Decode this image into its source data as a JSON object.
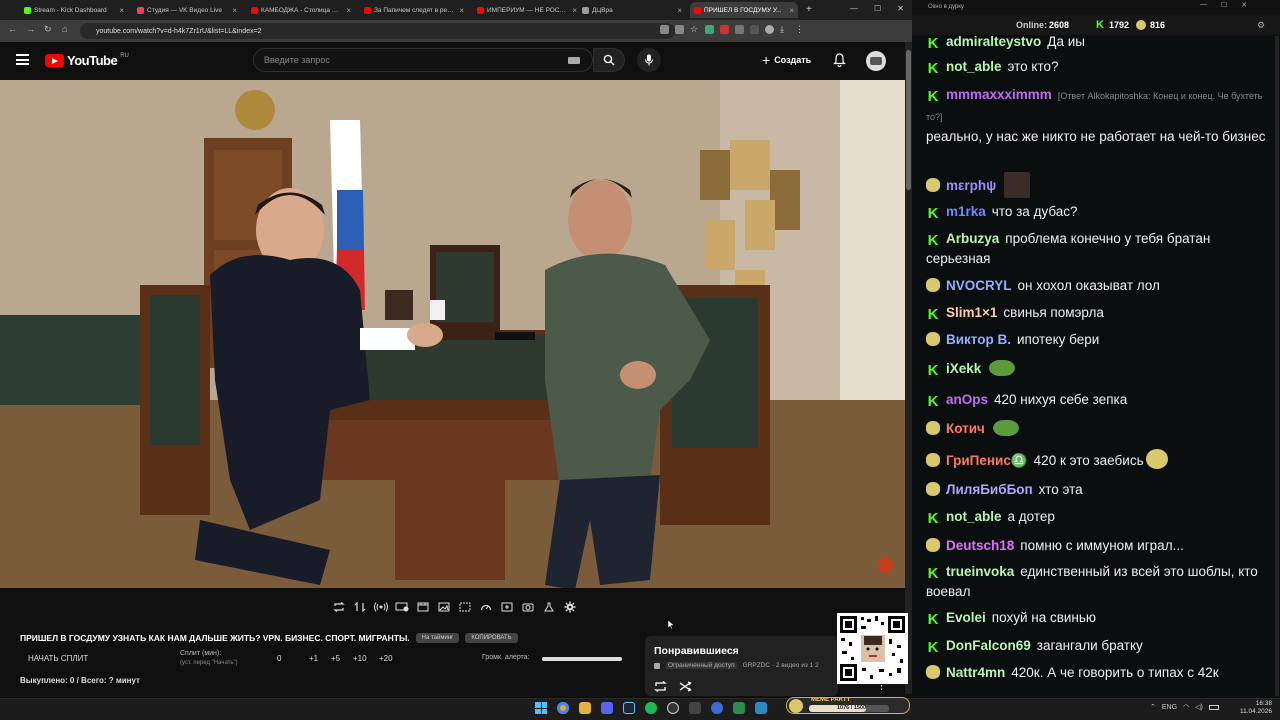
{
  "browser": {
    "tabs": [
      {
        "label": "Stream - Kick Dashboard",
        "color": "#53fc18"
      },
      {
        "label": "Студия — VK Видео Live",
        "color": "#ff3b5c"
      },
      {
        "label": "КАМБОДЖА - Столица Ми...",
        "color": "#ff0000"
      },
      {
        "label": "За Папичем следят в реал...",
        "color": "#ff0000"
      },
      {
        "label": "ИМПЕРИУМ — НЕ РОССИ...",
        "color": "#ff0000"
      },
      {
        "label": "ДЦВра",
        "color": "#999999"
      },
      {
        "label": "ПРИШЕЛ В ГОСДУМУ У...",
        "color": "#ff0000"
      }
    ],
    "url": "youtube.com/watch?v=d-h4k7Zr1rU&list=LL&index=2"
  },
  "youtube": {
    "logo": "YouTube",
    "region": "RU",
    "search_placeholder": "Введите запрос",
    "create_label": "Создать"
  },
  "video": {
    "title": "ПРИШЕЛ В ГОСДУМУ УЗНАТЬ КАК НАМ ДАЛЬШЕ ЖИТЬ? VPN. БИЗНЕС. СПОРТ. МИГРАНТЫ.",
    "pill1": "На тайминг",
    "pill2": "КОПИРОВАТЬ"
  },
  "split": {
    "start_label": "НАЧАТЬ СПЛИТ",
    "split_label": "Сплит (мин):",
    "split_hint": "(уст. перед \"Начать\")",
    "value": "0",
    "buttons": [
      "+1",
      "+5",
      "+10",
      "+20"
    ],
    "volume_label": "Громк. алерта:",
    "volume_level": 1.0,
    "bought": "Выкуплено: 0 / Всего: ? минут"
  },
  "liked": {
    "title": "Понравившиеся",
    "access": "Ограниченный доступ",
    "meta": "GRPZDC · 2 видео из 1 2"
  },
  "chat": {
    "window_title": "Окно в дурку",
    "online_label": "Online:",
    "online_value": "2608",
    "k_count": "1792",
    "p_count": "816",
    "messages": [
      {
        "badge": "k",
        "user": "admiralteystvo",
        "color": "#b8f5b0",
        "text": "Да иы"
      },
      {
        "badge": "k",
        "user": "not_able",
        "color": "#b8f5b0",
        "text": "это кто?"
      },
      {
        "badge": "k",
        "user": "mmmaxxximmm",
        "color": "#c06cf0",
        "reply": "[Ответ Alkokapitoshka: Конец и конец. Че бухтеть то?]",
        "text": "реально, у нас же никто не работает на чей-то бизнес"
      },
      {
        "badge": "p",
        "user": "mεrphψ",
        "color": "#9b8cff",
        "text": ""
      },
      {
        "badge": "k",
        "user": "m1rka",
        "color": "#6b8cff",
        "text": "что за дубас?"
      },
      {
        "badge": "k",
        "user": "Arbuzya",
        "color": "#b8f5b0",
        "text": "проблема конечно у тебя братан серьезная"
      },
      {
        "badge": "p",
        "user": "NVOCRYL",
        "color": "#8fb0ff",
        "text": "он хохол оказыват лол"
      },
      {
        "badge": "k",
        "user": "Slim1×1",
        "color": "#ffd0a0",
        "text": "свинья помэрла"
      },
      {
        "badge": "p",
        "user": "Виктор В.",
        "color": "#8fb0ff",
        "text": "ипотеку бери"
      },
      {
        "badge": "k",
        "user": "iXekk",
        "color": "#b8f5b0",
        "text": ""
      },
      {
        "badge": "k",
        "user": "anOps",
        "color": "#c06cf0",
        "text": "420 нихуя себе зепка"
      },
      {
        "badge": "p",
        "user": "Котич",
        "color": "#ff7a5a",
        "text": ""
      },
      {
        "badge": "p",
        "user": "ГриПенис♎",
        "color": "#ff7a5a",
        "text": "420 к это заебись"
      },
      {
        "badge": "p",
        "user": "ЛиляБибБоп",
        "color": "#b0a8ff",
        "text": "хто эта"
      },
      {
        "badge": "k",
        "user": "not_able",
        "color": "#b8f5b0",
        "text": "а дотер"
      },
      {
        "badge": "p",
        "user": "Deutsch18",
        "color": "#e070ff",
        "text": "помню с иммуном играл..."
      },
      {
        "badge": "k",
        "user": "trueinvoka",
        "color": "#b8f5b0",
        "text": "единственный из всей это шоблы, кто воевал"
      },
      {
        "badge": "k",
        "user": "Evolei",
        "color": "#b8f5b0",
        "text": "похуй на свинью"
      },
      {
        "badge": "k",
        "user": "DonFalcon69",
        "color": "#b8f5b0",
        "text": "загангали братку"
      },
      {
        "badge": "p",
        "user": "Nattr4mn",
        "color": "#b8f5b0",
        "text": "420к. А че говорить о типах с 42к"
      }
    ]
  },
  "taskbar": {
    "meme_label": "MEME PARTY",
    "meme_progress": "1076 / 1500",
    "lang": "ENG",
    "time": "16:38",
    "date": "11.04.2026"
  }
}
